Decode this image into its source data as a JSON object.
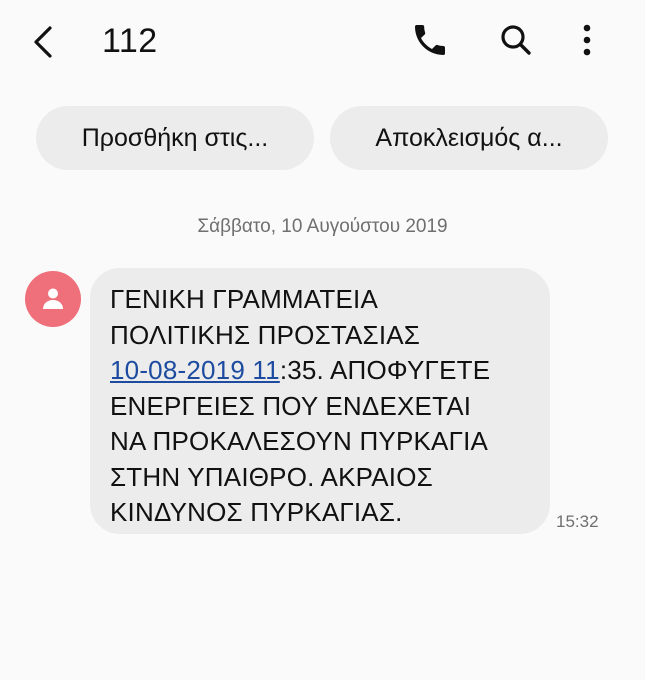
{
  "header": {
    "title": "112",
    "back_icon": "chevron-left-icon",
    "call_icon": "phone-icon",
    "search_icon": "search-icon",
    "more_icon": "more-vertical-icon"
  },
  "chips": {
    "add_contact": "Προσθήκη στις...",
    "block": "Αποκλεισμός α..."
  },
  "conversation": {
    "date_separator": "Σάββατο, 10 Αυγούστου 2019",
    "avatar_icon": "person-icon",
    "avatar_color": "#ef6f7b",
    "message": {
      "line1": "ΓΕΝΙΚΗ ΓΡΑΜΜΑΤΕΙΑ",
      "line2": "ΠΟΛΙΤΙΚΗΣ ΠΡΟΣΤΑΣΙΑΣ",
      "link": "10-08-2019 11",
      "line3_rest": ":35. ΑΠΟΦΥΓΕΤΕ",
      "line4": "ΕΝΕΡΓΕΙΕΣ ΠΟΥ ΕΝΔΕΧΕΤΑΙ",
      "line5": "ΝΑ ΠΡΟΚΑΛΕΣΟΥΝ ΠΥΡΚΑΓΙΑ",
      "line6": "ΣΤΗΝ ΥΠΑΙΘΡΟ. ΑΚΡΑΙΟΣ",
      "line7": "ΚΙΝΔΥΝΟΣ ΠΥΡΚΑΓΙΑΣ."
    },
    "time": "15:32",
    "link_color": "#1c4ba0"
  }
}
